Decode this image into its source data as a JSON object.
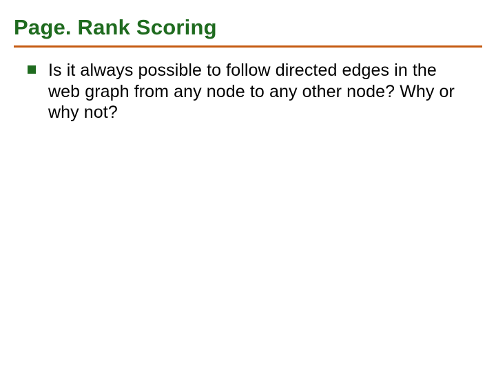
{
  "slide": {
    "title": "Page. Rank Scoring",
    "bullets": [
      {
        "text": "Is it always possible to follow directed edges in the web graph from any node to any other node? Why or why not?"
      }
    ]
  },
  "colors": {
    "title": "#1f6b1f",
    "rule": "#c55a11",
    "bullet": "#1f6b1f"
  }
}
